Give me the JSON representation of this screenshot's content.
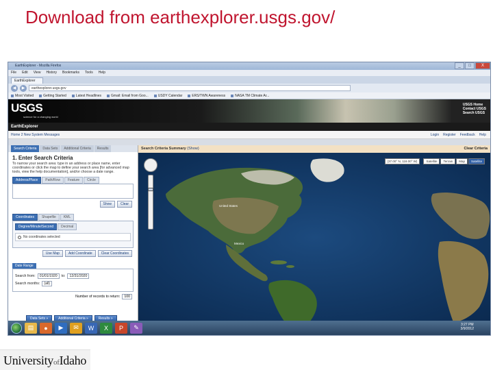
{
  "slide": {
    "title": "Download from earthexplorer.usgs.gov/",
    "footer_logo_text": "University of Idaho"
  },
  "browser": {
    "window_title": "EarthExplorer - Mozilla Firefox",
    "menu": [
      "File",
      "Edit",
      "View",
      "History",
      "Bookmarks",
      "Tools",
      "Help"
    ],
    "tab_label": "EarthExplorer",
    "url": "earthexplorer.usgs.gov",
    "bookmarks": [
      "Most Visited",
      "Getting Started",
      "Latest Headlines",
      "Gmail: Email from Goo...",
      "USDY Calendar",
      "ERS/TWN Awareness",
      "NASA TM Climate Ar..."
    ],
    "win_buttons": [
      "_",
      "□",
      "X"
    ]
  },
  "usgs": {
    "logo": "USGS",
    "tagline": "science for a changing world",
    "links": [
      "USGS Home",
      "Contact USGS",
      "Search USGS"
    ],
    "app_title": "EarthExplorer",
    "site_nav": "Home  2 New System Messages",
    "site_right": [
      "Login",
      "Register",
      "Feedback",
      "Help"
    ]
  },
  "left_panel": {
    "tabs": [
      "Search Criteria",
      "Data Sets",
      "Additional Criteria",
      "Results"
    ],
    "heading": "1. Enter Search Criteria",
    "description": "To narrow your search area: type in an address or place name, enter coordinates or click the map to define your search area [for advanced map tools, view the help documentation], and/or choose a date range.",
    "address_tabs": [
      "Address/Place",
      "Path/Row",
      "Feature",
      "Circle"
    ],
    "show_label": "Show",
    "clear_label": "Clear",
    "coord_tabs": [
      "Coordinates",
      "Shapefile",
      "KML"
    ],
    "coord_format_tabs": [
      "Degree/Minute/Second",
      "Decimal"
    ],
    "no_coords": "No coordinates selected",
    "coord_buttons": [
      "Use Map",
      "Add Coordinate",
      "Clear Coordinates"
    ],
    "date_tab": "Date Range",
    "search_from_label": "Search from:",
    "search_from": "01/01/1920",
    "to_label": "to:",
    "search_to": "12/31/2020",
    "search_months_label": "Search months:",
    "search_months": "(all)",
    "records_label": "Number of records to return:",
    "records_value": "100",
    "bottom_buttons": [
      "Data Sets »",
      "Additional Criteria »",
      "Results »"
    ]
  },
  "right_panel": {
    "summary_label": "Search Criteria Summary",
    "summary_show": "(Show)",
    "clear_criteria": "Clear Criteria",
    "coord_readout": "(37.00° N, 118.00° W)",
    "map_types": [
      "Satellite",
      "Terrain",
      "Map",
      "Satellite"
    ],
    "map_labels": [
      "United States",
      "Mexico"
    ]
  },
  "taskbar": {
    "time": "3:27 PM",
    "date": "3/9/2012",
    "icons": [
      "explorer",
      "firefox",
      "media",
      "outlook",
      "word",
      "excel",
      "powerpoint",
      "paint"
    ]
  },
  "colors": {
    "title_red": "#c0152f",
    "usgs_blue": "#3c6fb3",
    "ocean": "#0f3562",
    "summary_bg": "#f3e1c4"
  }
}
